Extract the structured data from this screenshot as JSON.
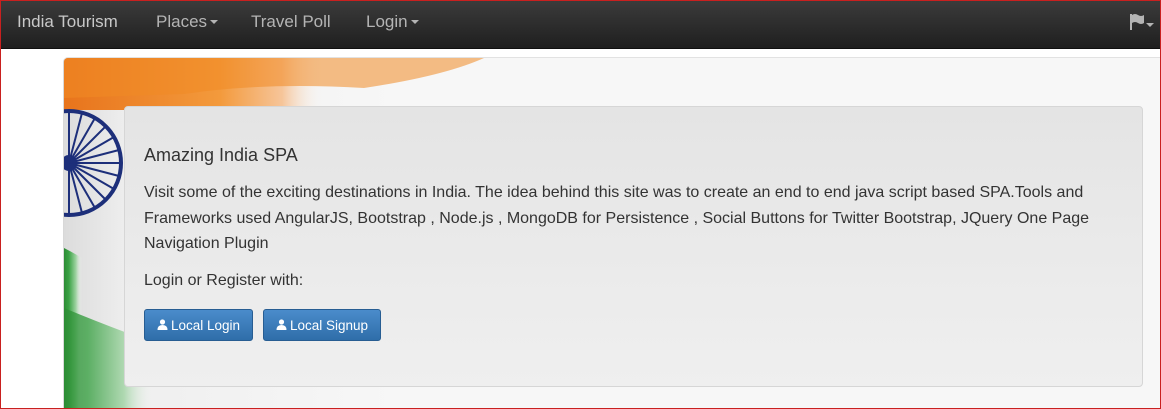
{
  "navbar": {
    "brand": "India Tourism",
    "items": [
      {
        "label": "Places",
        "dropdown": true
      },
      {
        "label": "Travel Poll",
        "dropdown": false
      },
      {
        "label": "Login",
        "dropdown": true
      }
    ],
    "language_icon": "flag-icon"
  },
  "hero": {
    "title": "Amazing India SPA",
    "description": "Visit some of the exciting destinations in India. The idea behind this site was to create an end to end java script based SPA.Tools and Frameworks used AngularJS, Bootstrap , Node.js , MongoDB for Persistence , Social Buttons for Twitter Bootstrap, JQuery One Page Navigation Plugin",
    "login_prompt": "Login or Register with:",
    "buttons": [
      {
        "label": "Local Login",
        "icon": "user-icon"
      },
      {
        "label": "Local Signup",
        "icon": "user-icon"
      }
    ]
  },
  "colors": {
    "navbar_bg": "#222222",
    "button_primary": "#337ab7",
    "saffron": "#f08a24",
    "green": "#2f9a3a",
    "chakra_blue": "#1d2f7a"
  }
}
